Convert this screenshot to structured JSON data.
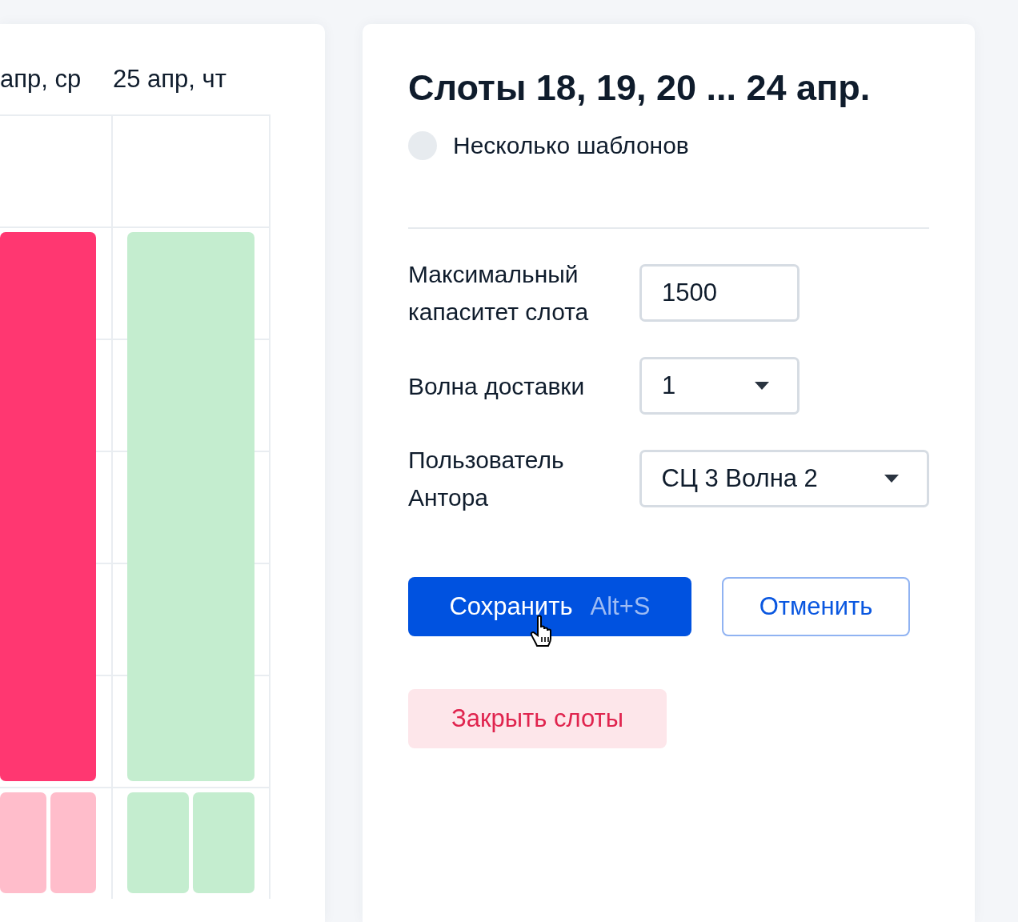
{
  "calendar": {
    "days": [
      {
        "label": "апр, ср",
        "slots": [
          {
            "kind": "big",
            "color": "#ff3771"
          },
          {
            "kind": "half",
            "color": "#ffbdcb"
          },
          {
            "kind": "half",
            "color": "#ffbdcb"
          }
        ]
      },
      {
        "label": "25 апр, чт",
        "slots": [
          {
            "kind": "big",
            "color": "#c4edcf"
          },
          {
            "kind": "half",
            "color": "#c4edcf"
          },
          {
            "kind": "half",
            "color": "#c4edcf"
          }
        ]
      }
    ]
  },
  "panel": {
    "title": "Слоты 18, 19, 20 ... 24 апр.",
    "toggle": {
      "label": "Несколько шаблонов",
      "on": false
    },
    "form": [
      {
        "kind": "input",
        "label": "Максимальный капаситет слота",
        "value": "1500",
        "wide": false
      },
      {
        "kind": "select",
        "label": "Волна доставки",
        "value": "1",
        "wide": false
      },
      {
        "kind": "select",
        "label": "Пользователь Антора",
        "value": "СЦ 3 Волна 2",
        "wide": true
      }
    ],
    "save": {
      "label": "Сохранить",
      "shortcut": "Alt+S"
    },
    "cancel": {
      "label": "Отменить"
    },
    "close": {
      "label": "Закрыть слоты"
    }
  }
}
